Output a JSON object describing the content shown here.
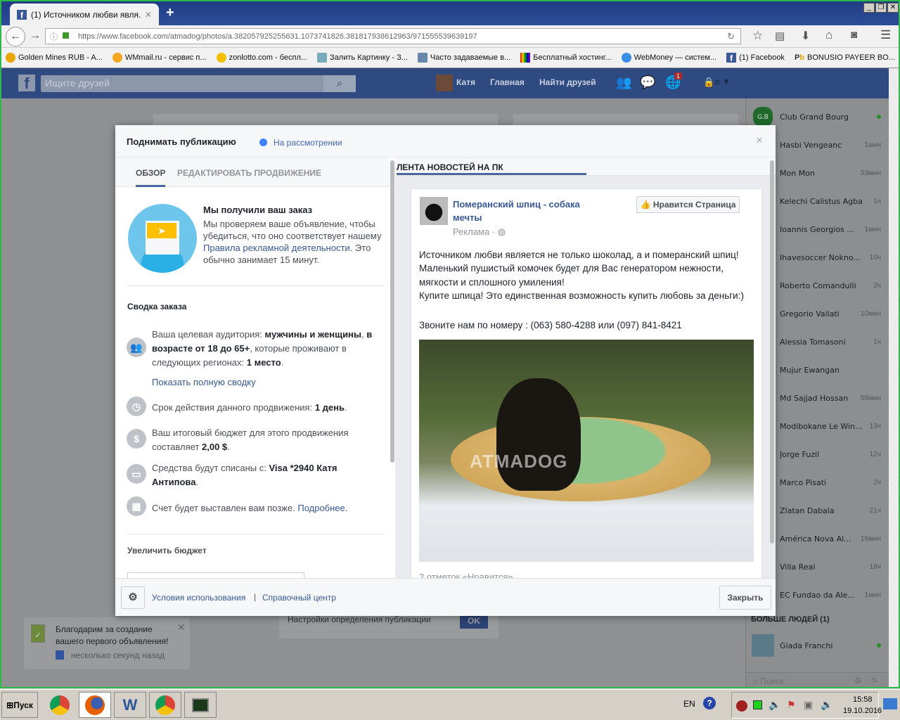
{
  "browser": {
    "tab_title": "(1) Источником любви явля...",
    "url": "https://www.facebook.com/atmadog/photos/a.382057925255631.1073741826.381817938612963/971555539639197",
    "bookmarks": [
      "Golden Mines RUB - A...",
      "WMmail.ru - сервис п...",
      "zonlotto.com - беспл...",
      "Залить Картинку - З...",
      "Часто задаваемые в...",
      "Бесплатный хостинг...",
      "WebMoney — систем...",
      "(1) Facebook",
      "BONUSIO PAYEER BO..."
    ]
  },
  "fb": {
    "search_placeholder": "Ищите друзей",
    "user_name": "Катя",
    "nav_home": "Главная",
    "nav_find_friends": "Найти друзей",
    "notification_count": "1"
  },
  "modal": {
    "title": "Поднимать публикацию",
    "status": "На рассмотрении",
    "status_color": "#4080ff",
    "tabs": [
      "ОБЗОР",
      "РЕДАКТИРОВАТЬ ПРОДВИЖЕНИЕ"
    ],
    "received_title": "Мы получили ваш заказ",
    "received_text1": "Мы проверяем ваше объявление, чтобы убедиться, что оно соответствует нашему ",
    "received_link": "Правила рекламной деятельности",
    "received_text2": ". Это обычно занимает 15 минут.",
    "summary_title": "Сводка заказа",
    "audience_1": "Ваша целевая аудитория: ",
    "audience_b1": "мужчины и женщины",
    "audience_2": ", ",
    "audience_b2": "в возрасте от 18 до 65+",
    "audience_3": ", которые проживают в следующих регионах: ",
    "audience_b3": "1 место",
    "show_full": "Показать полную сводку",
    "duration_1": "Срок действия данного продвижения: ",
    "duration_b": "1 день",
    "budget_1": "Ваш итоговый бюджет для этого продвижения составляет ",
    "budget_b": "2,00 $",
    "payment_1": "Средства будут списаны с: ",
    "payment_b": "Visa *2940 Катя Антипова",
    "invoice_1": "Счет будет выставлен вам позже. ",
    "invoice_link": "Подробнее",
    "increase_budget": "Увеличить бюджет",
    "preview_tab": "ЛЕНТА НОВОСТЕЙ НА ПК",
    "page_name": "Померанский шпиц - собака мечты",
    "sponsored": "Реклама",
    "like_page": "Нравится Страница",
    "post_text": "Источником любви является не только шоколад, а и померанский шпиц! Маленький пушистый комочек будет для Вас генератором нежности, мягкости и сплошного умиления!\nКупите шпица! Это единственная возможность купить любовь за деньги:)",
    "post_phone": "Звоните нам по номеру : (063) 580-4288 или (097) 841-8421",
    "watermark": "ATMADOG",
    "likes": "2 отметок «Нравится»",
    "footer_terms": "Условия использования",
    "footer_help": "Справочный центр",
    "close": "Закрыть"
  },
  "background": {
    "settings_text": "Настройки определения публикации",
    "ok": "OK",
    "toast_text": "Благодарим за создание вашего первого объявления!",
    "toast_time": "несколько секунд назад"
  },
  "chat": {
    "contacts": [
      {
        "name": "Club Grand Bourg",
        "time": "",
        "online": true
      },
      {
        "name": "Hasbi Vengeanc",
        "time": "1мин"
      },
      {
        "name": "Mon Mon",
        "time": "53мин"
      },
      {
        "name": "Kelechi Calistus Agba",
        "time": "1ч"
      },
      {
        "name": "Ioannis Georgios ...",
        "time": "1мин"
      },
      {
        "name": "Ihavesoccer Nokno...",
        "time": "10ч"
      },
      {
        "name": "Roberto Comandulli",
        "time": "2ч"
      },
      {
        "name": "Gregorio Vailati",
        "time": "10мин"
      },
      {
        "name": "Alessia Tomasoni",
        "time": "1ч"
      },
      {
        "name": "Mujur Ewangan",
        "time": ""
      },
      {
        "name": "Md Sajjad Hossan",
        "time": "58мин"
      },
      {
        "name": "Modibokane Le Win...",
        "time": "13ч"
      },
      {
        "name": "Jorge Fuzil",
        "time": "12ч"
      },
      {
        "name": "Marco Pisati",
        "time": "2ч"
      },
      {
        "name": "Zlatan Dabala",
        "time": "21ч"
      },
      {
        "name": "América Nova Al...",
        "time": "16мин"
      },
      {
        "name": "Villa Real",
        "time": "18ч"
      },
      {
        "name": "EC Fundao da Ale...",
        "time": "1мин"
      }
    ],
    "more_people": "БОЛЬШЕ ЛЮДЕЙ (1)",
    "more_contact": "Giada Franchi",
    "search_placeholder": "Поиск"
  },
  "taskbar": {
    "start": "Пуск",
    "lang": "EN",
    "time": "15:58",
    "date": "19.10.2016"
  }
}
